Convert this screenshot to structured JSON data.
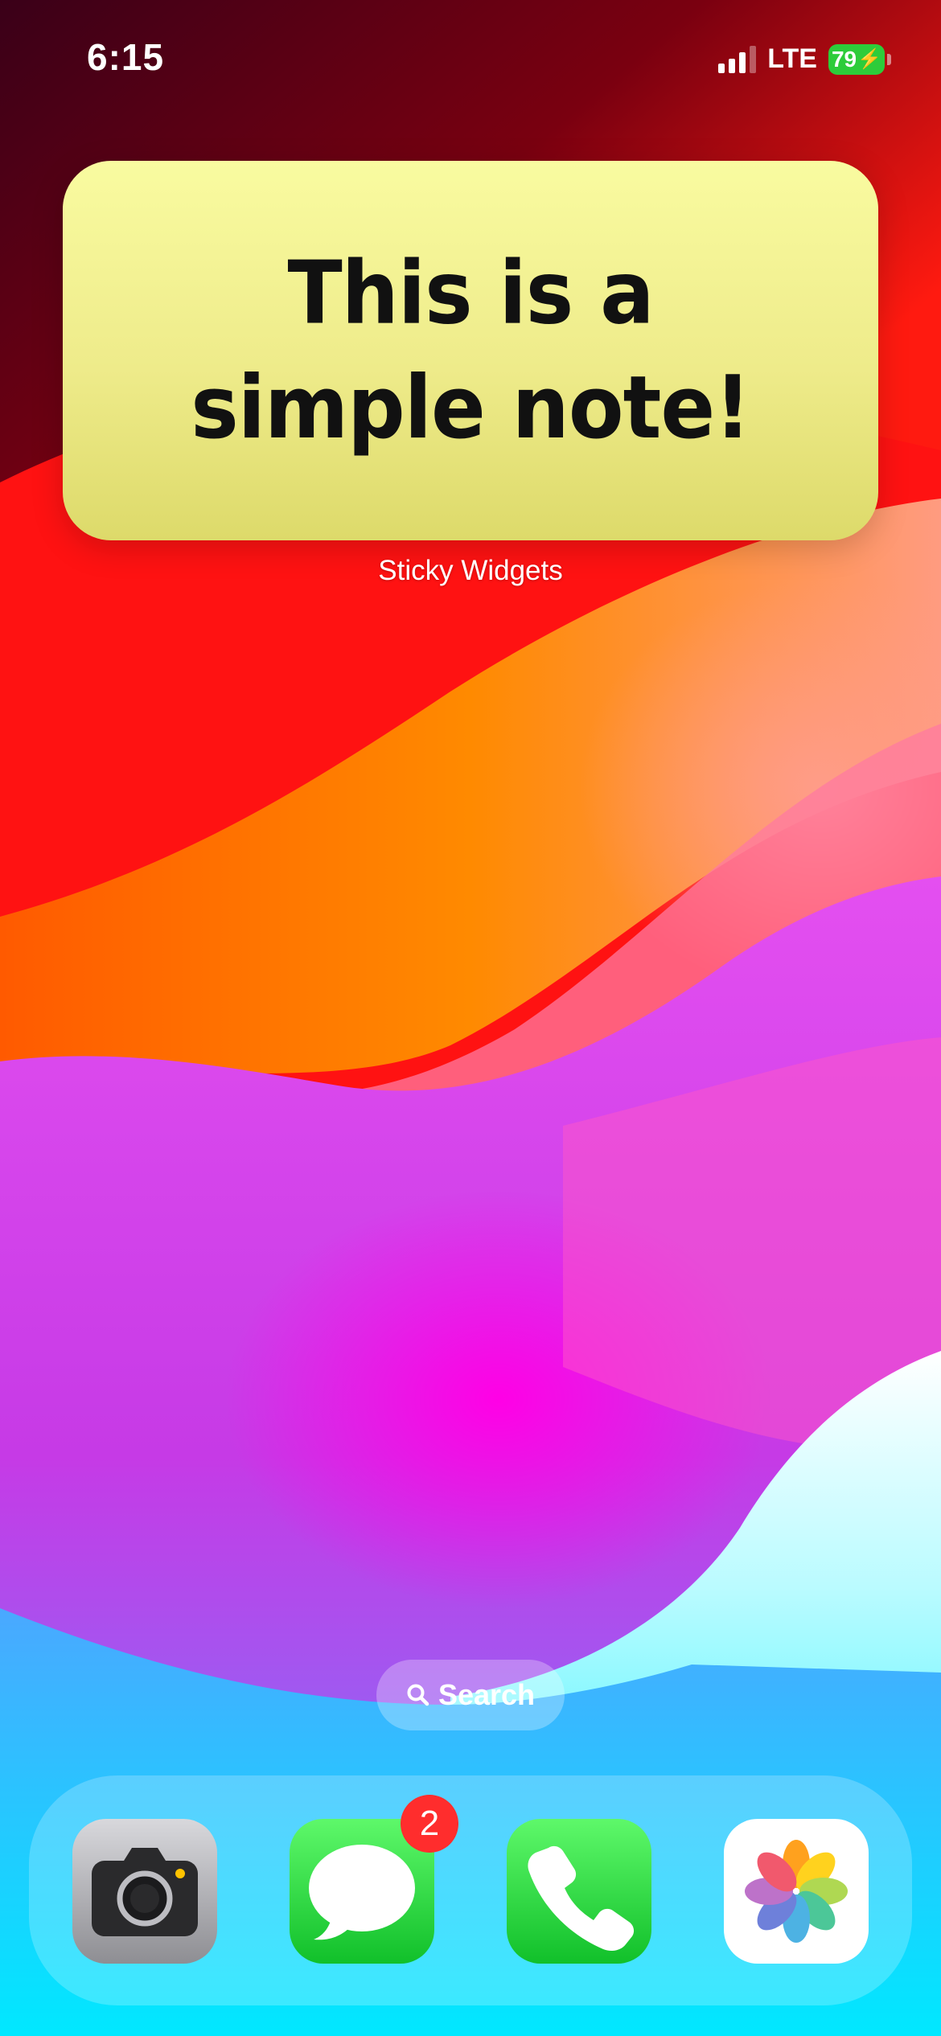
{
  "status_bar": {
    "time": "6:15",
    "network": "LTE",
    "battery_percent": "79"
  },
  "widget": {
    "note_line1": "This is a",
    "note_line2": "simple note!",
    "app_label": "Sticky Widgets"
  },
  "search": {
    "label": "Search"
  },
  "dock": {
    "apps": [
      {
        "name": "Camera",
        "icon": "camera-icon"
      },
      {
        "name": "Messages",
        "icon": "messages-icon",
        "badge": "2"
      },
      {
        "name": "Phone",
        "icon": "phone-icon"
      },
      {
        "name": "Photos",
        "icon": "photos-icon"
      }
    ]
  },
  "colors": {
    "note_background": "#f3f19a",
    "battery_green": "#2dcc3a",
    "badge_red": "#ff2d2d",
    "messages_green": "#22d23a"
  }
}
